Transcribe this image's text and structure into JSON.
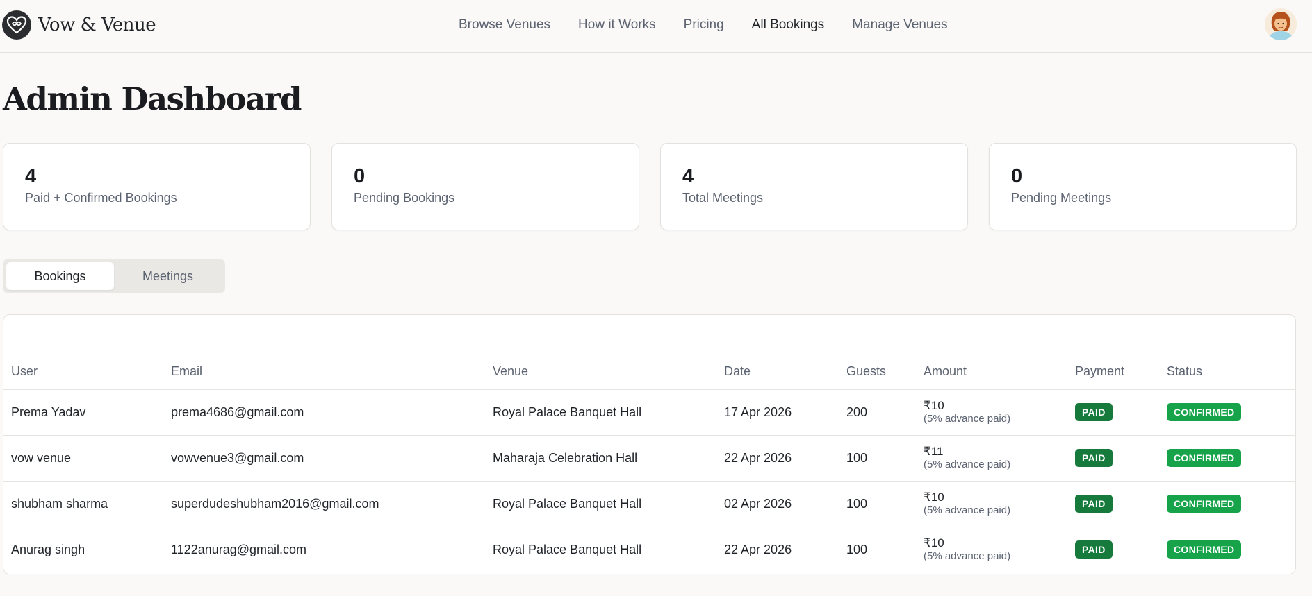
{
  "brand": {
    "name": "Vow & Venue",
    "logo_icon": "heart-infinity-icon"
  },
  "nav": {
    "items": [
      {
        "label": "Browse Venues"
      },
      {
        "label": "How it Works"
      },
      {
        "label": "Pricing"
      },
      {
        "label": "All Bookings",
        "active": true
      },
      {
        "label": "Manage Venues"
      }
    ]
  },
  "page": {
    "title": "Admin Dashboard"
  },
  "stats": [
    {
      "value": "4",
      "label": "Paid + Confirmed Bookings"
    },
    {
      "value": "0",
      "label": "Pending Bookings"
    },
    {
      "value": "4",
      "label": "Total Meetings"
    },
    {
      "value": "0",
      "label": "Pending Meetings"
    }
  ],
  "tabs": [
    {
      "label": "Bookings",
      "active": true
    },
    {
      "label": "Meetings"
    }
  ],
  "table": {
    "columns": [
      "User",
      "Email",
      "Venue",
      "Date",
      "Guests",
      "Amount",
      "Payment",
      "Status"
    ],
    "rows": [
      {
        "user": "Prema Yadav",
        "email": "prema4686@gmail.com",
        "venue": "Royal Palace Banquet Hall",
        "date": "17 Apr 2026",
        "guests": "200",
        "amount": "₹10",
        "amount_note": "(5% advance paid)",
        "payment": "PAID",
        "status": "CONFIRMED"
      },
      {
        "user": "vow venue",
        "email": "vowvenue3@gmail.com",
        "venue": "Maharaja Celebration Hall",
        "date": "22 Apr 2026",
        "guests": "100",
        "amount": "₹11",
        "amount_note": "(5% advance paid)",
        "payment": "PAID",
        "status": "CONFIRMED"
      },
      {
        "user": "shubham sharma",
        "email": "superdudeshubham2016@gmail.com",
        "venue": "Royal Palace Banquet Hall",
        "date": "02 Apr 2026",
        "guests": "100",
        "amount": "₹10",
        "amount_note": "(5% advance paid)",
        "payment": "PAID",
        "status": "CONFIRMED"
      },
      {
        "user": "Anurag singh",
        "email": "1122anurag@gmail.com",
        "venue": "Royal Palace Banquet Hall",
        "date": "22 Apr 2026",
        "guests": "100",
        "amount": "₹10",
        "amount_note": "(5% advance paid)",
        "payment": "PAID",
        "status": "CONFIRMED"
      }
    ]
  },
  "colors": {
    "paid": "#157a3c",
    "confirmed": "#16a34a",
    "background": "#faf9f7"
  }
}
